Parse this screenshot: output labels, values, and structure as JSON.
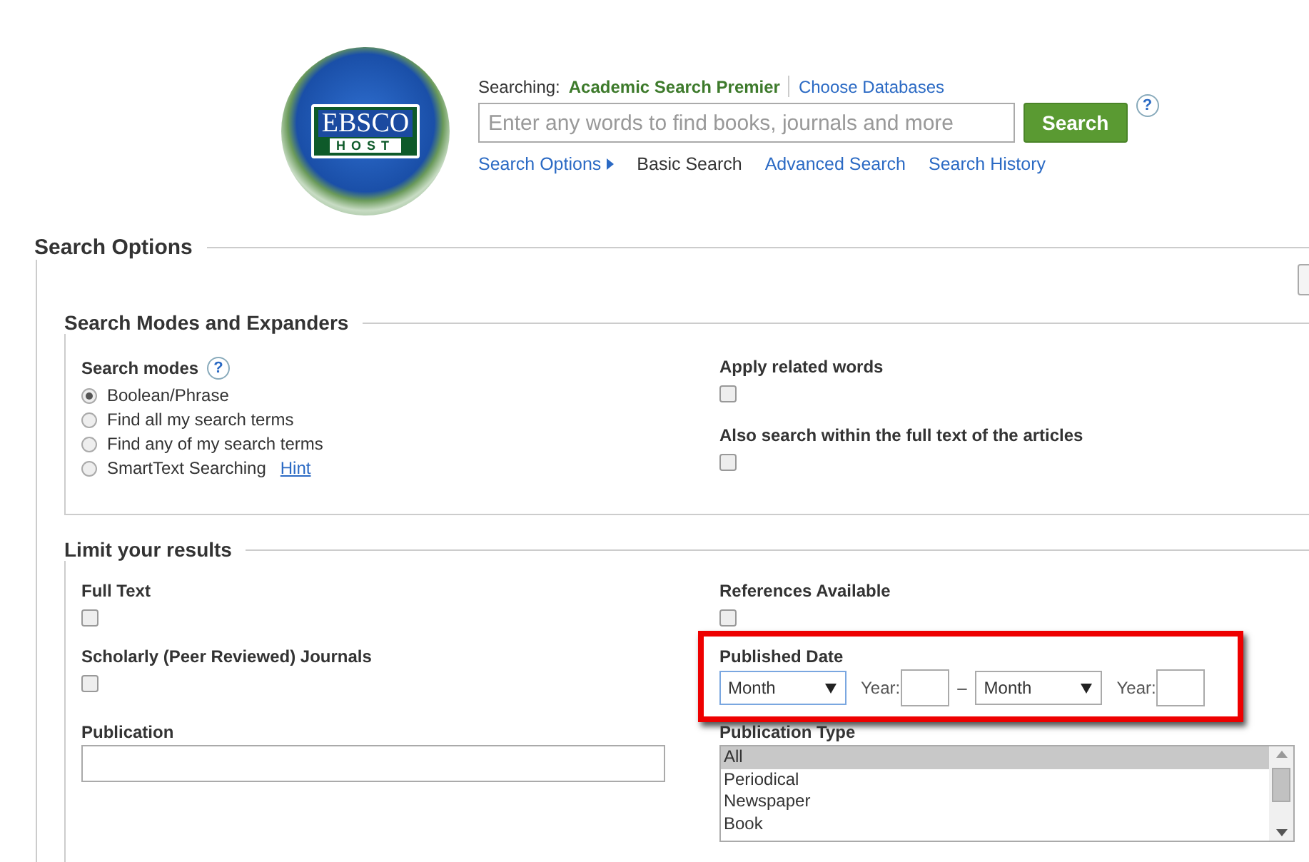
{
  "logo": {
    "line1": "EBSCO",
    "line2": "HOST"
  },
  "header": {
    "searching_label": "Searching:",
    "database": "Academic Search Premier",
    "choose_link": "Choose Databases",
    "search_placeholder": "Enter any words to find books, journals and more",
    "search_button": "Search",
    "help": "?",
    "links": [
      {
        "label": "Search Options",
        "kind": "toggle",
        "selected": false
      },
      {
        "label": "Basic Search",
        "kind": "link",
        "selected": true
      },
      {
        "label": "Advanced Search",
        "kind": "link",
        "selected": false
      },
      {
        "label": "Search History",
        "kind": "link",
        "selected": false
      }
    ]
  },
  "search_options": {
    "title": "Search Options",
    "modes_section": {
      "title": "Search Modes and Expanders",
      "search_modes": {
        "label": "Search modes",
        "help": "?",
        "options": [
          {
            "label": "Boolean/Phrase",
            "selected": true
          },
          {
            "label": "Find all my search terms",
            "selected": false
          },
          {
            "label": "Find any of my search terms",
            "selected": false
          },
          {
            "label": "SmartText Searching",
            "selected": false,
            "hint": "Hint"
          }
        ]
      },
      "expanders": [
        {
          "label": "Apply related words",
          "checked": false
        },
        {
          "label": "Also search within the full text of the articles",
          "checked": false
        }
      ]
    },
    "limits": {
      "title": "Limit your results",
      "left": [
        {
          "kind": "checkbox",
          "label": "Full Text",
          "checked": false
        },
        {
          "kind": "checkbox",
          "label": "Scholarly (Peer Reviewed) Journals",
          "checked": false
        },
        {
          "kind": "text",
          "label": "Publication"
        }
      ],
      "right": [
        {
          "kind": "checkbox",
          "label": "References Available",
          "checked": false
        },
        {
          "kind": "date",
          "label": "Published Date",
          "highlighted": true,
          "from_month": "Month",
          "from_year_label": "Year:",
          "separator": "–",
          "to_month": "Month",
          "to_year_label": "Year:"
        },
        {
          "kind": "list",
          "label": "Publication Type",
          "options": [
            {
              "label": "All",
              "selected": true
            },
            {
              "label": "Periodical",
              "selected": false
            },
            {
              "label": "Newspaper",
              "selected": false
            },
            {
              "label": "Book",
              "selected": false
            }
          ]
        }
      ]
    }
  }
}
